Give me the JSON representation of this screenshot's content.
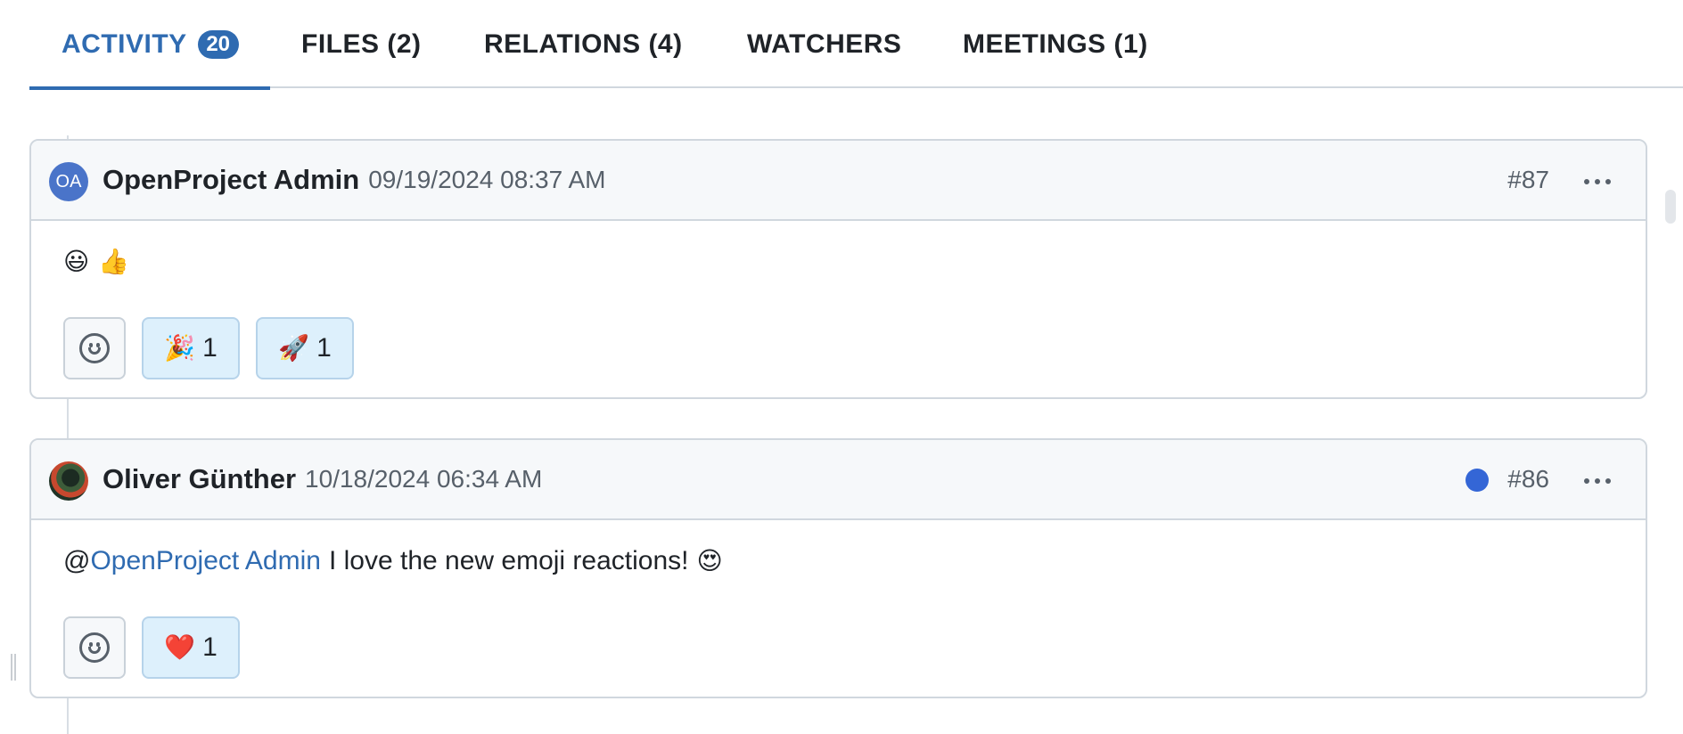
{
  "tabs": [
    {
      "label": "ACTIVITY",
      "badge": "20"
    },
    {
      "label": "FILES (2)"
    },
    {
      "label": "RELATIONS (4)"
    },
    {
      "label": "WATCHERS"
    },
    {
      "label": "MEETINGS (1)"
    }
  ],
  "comments": [
    {
      "avatar_initials": "OA",
      "author": "OpenProject Admin",
      "timestamp": "09/19/2024 08:37 AM",
      "number": "#87",
      "text_emoji_1": "😃",
      "text_emoji_2": "👍",
      "reactions": [
        {
          "emoji": "🎉",
          "count": "1"
        },
        {
          "emoji": "🚀",
          "count": "1"
        }
      ]
    },
    {
      "author": "Oliver Günther",
      "timestamp": "10/18/2024 06:34 AM",
      "number": "#86",
      "unread": true,
      "mention": "@",
      "mention_name": "OpenProject Admin",
      "text": "I love the new emoji reactions!",
      "text_emoji": "😍",
      "reactions": [
        {
          "emoji": "❤️",
          "count": "1"
        }
      ]
    }
  ],
  "colors": {
    "accent": "#2f6bb1",
    "unread_dot": "#3466d6",
    "reaction_bg": "#ddf0fc",
    "header_bg": "#f6f8fa"
  },
  "icons": {
    "add_reaction": "smiley-icon",
    "more": "more-horizontal-icon"
  }
}
